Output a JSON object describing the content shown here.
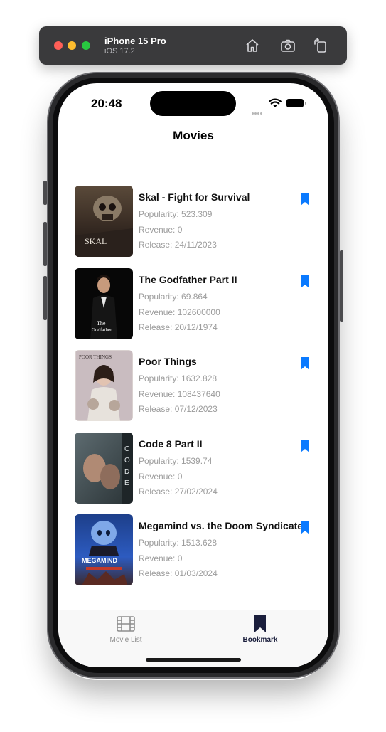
{
  "simulator": {
    "device_name": "iPhone 15 Pro",
    "os_version": "iOS 17.2",
    "buttons": [
      "home-icon",
      "screenshot-icon",
      "rotate-icon"
    ]
  },
  "status_bar": {
    "time": "20:48"
  },
  "nav": {
    "title": "Movies"
  },
  "colors": {
    "accent": "#0a7aff",
    "tab_selected": "#1a1e3c",
    "tab_unselected": "#8e8e8e",
    "meta_text": "#9c9c9c"
  },
  "movies": [
    {
      "title": "Skal - Fight for Survival",
      "popularity": "Popularity: 523.309",
      "revenue": "Revenue: 0",
      "release": "Release: 24/11/2023",
      "bookmarked": true
    },
    {
      "title": "The Godfather Part II",
      "popularity": "Popularity: 69.864",
      "revenue": "Revenue: 102600000",
      "release": "Release: 20/12/1974",
      "bookmarked": true
    },
    {
      "title": "Poor Things",
      "popularity": "Popularity: 1632.828",
      "revenue": "Revenue: 108437640",
      "release": "Release: 07/12/2023",
      "bookmarked": true
    },
    {
      "title": "Code 8 Part II",
      "popularity": "Popularity: 1539.74",
      "revenue": "Revenue: 0",
      "release": "Release: 27/02/2024",
      "bookmarked": true
    },
    {
      "title": "Megamind vs. the Doom Syndicate",
      "popularity": "Popularity: 1513.628",
      "revenue": "Revenue: 0",
      "release": "Release: 01/03/2024",
      "bookmarked": true
    }
  ],
  "tabs": [
    {
      "label": "Movie List",
      "icon": "film-icon",
      "selected": false
    },
    {
      "label": "Bookmark",
      "icon": "bookmark-icon",
      "selected": true
    }
  ]
}
